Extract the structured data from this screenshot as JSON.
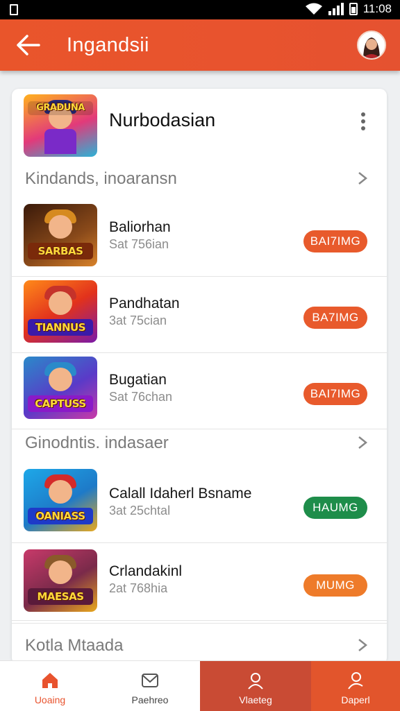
{
  "status_bar": {
    "time": "11:08"
  },
  "app_bar": {
    "title": "Ingandsii"
  },
  "featured": {
    "title": "Nurbodasian",
    "banner": "GRADUNA"
  },
  "sections": [
    {
      "label": "Kindands, inoaransn",
      "items": [
        {
          "name": "Baliorhan",
          "sub": "Sat 756ian",
          "action": "BAI7IMG",
          "action_color": "#e85a2c",
          "banner": "SARBAS",
          "bg": "#6e3a1c",
          "hat": "#d68a1f"
        },
        {
          "name": "Pandhatan",
          "sub": "3at 75cian",
          "action": "BA7IMG",
          "action_color": "#e85a2c",
          "banner": "TIANNUS",
          "bg": "#e25a1c",
          "hat": "#c5322a"
        },
        {
          "name": "Bugatian",
          "sub": "Sat 76chan",
          "action": "BAI7IMG",
          "action_color": "#e85a2c",
          "banner": "CAPTUSS",
          "bg": "#5a3ac8",
          "hat": "#2a8ac9"
        }
      ]
    },
    {
      "label": "Ginodntis. indasaer",
      "items": [
        {
          "name": "Calall Idaherl Bsname",
          "sub": "3at 25chtal",
          "action": "HAUMG",
          "action_color": "#1e8d4a",
          "banner": "OANIASS",
          "bg": "#1e7ac8",
          "hat": "#d42a2a"
        },
        {
          "name": "Crlandakinl",
          "sub": "2at 768hia",
          "action": "MUMG",
          "action_color": "#ee7b2a",
          "banner": "MAESAS",
          "bg": "#7a2a4a",
          "hat": "#8a5a2a"
        }
      ]
    },
    {
      "label": "Kotla Mtaada",
      "items": []
    }
  ],
  "bottom_nav": [
    {
      "label": "Uoaing",
      "icon": "home-icon"
    },
    {
      "label": "Paehreo",
      "icon": "mail-icon"
    },
    {
      "label": "Vlaeteg",
      "icon": "user-icon"
    },
    {
      "label": "Daperl",
      "icon": "profile-icon"
    }
  ],
  "colors": {
    "accent": "#e8532e",
    "active_tab": "#e8532e",
    "label": "#c94b34"
  }
}
